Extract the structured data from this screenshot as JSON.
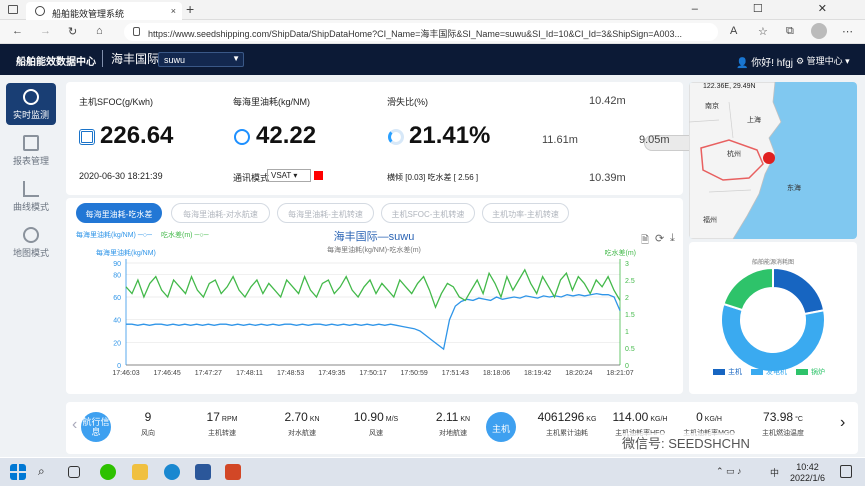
{
  "browser": {
    "tab_title": "船舶能效管理系统",
    "tab_close": "×",
    "new_tab": "+",
    "window_controls": "–  ☐  ✕",
    "url": "https://www.seedshipping.com/ShipData/ShipDataHome?CI_Name=海丰国际&SI_Name=suwu&SI_Id=10&CI_Id=3&ShipSign=A003...",
    "nav": {
      "back": "←",
      "forward": "→",
      "reload": "↻"
    }
  },
  "app": {
    "title": "船舶能效数据中心",
    "company": "海丰国际",
    "ship_select": "suwu",
    "user_greeting": "你好! hfgj",
    "manage_center": "管理中心"
  },
  "sidebar": {
    "items": [
      {
        "label": "实时监测",
        "icon": "gauge-icon",
        "active": true
      },
      {
        "label": "报表管理",
        "icon": "report-icon",
        "active": false
      },
      {
        "label": "曲线模式",
        "icon": "curve-icon",
        "active": false
      },
      {
        "label": "地图模式",
        "icon": "globe-icon",
        "active": false
      }
    ]
  },
  "kpi": {
    "sfoc_label": "主机SFOC(g/Kwh)",
    "sfoc_value": "226.64",
    "timestamp": "2020-06-30 18:21:39",
    "nm_label": "每海里油耗(kg/NM)",
    "nm_value": "42.22",
    "comm_label": "通讯模式",
    "comm_value": "VSAT",
    "slip_label": "滑失比(%)",
    "slip_value": "21.41%",
    "trim_text": "横倾 [0.03] 吃水差 [ 2.56 ]",
    "colors": {
      "sfoc_icon": "#1a73c9",
      "nm_icon": "#1e90ff",
      "slip_icon": "#2aa0ff",
      "status_red": "#ff0000"
    }
  },
  "draft": {
    "fwd": "10.42m",
    "left": "11.61m",
    "right": "9.05m",
    "aft": "10.39m"
  },
  "map": {
    "coords": "122.36E, 29.49N",
    "labels": [
      "南京",
      "上海",
      "杭州",
      "东海",
      "福州"
    ],
    "colors": {
      "sea": "#80c8f0",
      "land": "#f4f4f4",
      "province": "#e86060",
      "ship": "#e02020"
    }
  },
  "chart_tabs": [
    {
      "label": "每海里油耗-吃水差",
      "active": true
    },
    {
      "label": "每海里油耗-对水航速",
      "active": false
    },
    {
      "label": "每海里油耗-主机转速",
      "active": false
    },
    {
      "label": "主机SFOC-主机转速",
      "active": false
    },
    {
      "label": "主机功率-主机转速",
      "active": false
    }
  ],
  "chart_tools": {
    "save": "🗎",
    "refresh": "⟳",
    "download": "⤓"
  },
  "chart_data": {
    "type": "line",
    "title": "海丰国际—suwu",
    "subtitle": "每海里油耗(kg/NM)-吃水差(m)",
    "legend": [
      "每海里油耗(kg/NM)",
      "吃水差(m)"
    ],
    "ylabel_left": "每海里油耗(kg/NM)",
    "ylabel_right": "吃水差(m)",
    "ylim_left": [
      0,
      90
    ],
    "ylim_right": [
      0,
      3
    ],
    "yticks_left": [
      "90",
      "80",
      "60",
      "40",
      "20",
      "0"
    ],
    "yticks_right": [
      "3",
      "2.5",
      "2",
      "1.5",
      "1",
      "0.5",
      "0"
    ],
    "categories": [
      "17:46:03",
      "17:46:45",
      "17:47:27",
      "17:48:11",
      "17:48:53",
      "17:49:35",
      "17:50:17",
      "17:50:59",
      "17:51:43",
      "18:18:06",
      "18:19:42",
      "18:20:24",
      "18:21:07"
    ],
    "series": [
      {
        "name": "每海里油耗(kg/NM)",
        "color": "#2f95e8",
        "values": [
          36,
          36,
          35,
          36,
          35,
          36,
          36,
          35,
          36,
          35,
          36,
          35,
          36,
          35,
          36,
          35,
          36,
          36,
          35,
          36,
          35,
          36,
          35,
          36,
          35,
          36,
          35,
          36,
          36,
          35,
          36,
          35,
          36,
          36,
          35,
          36,
          35,
          36,
          35,
          36,
          35,
          36,
          35,
          36,
          35,
          36,
          35,
          34,
          33,
          32,
          30,
          26,
          22,
          18,
          14,
          40,
          52,
          56,
          58,
          57,
          59,
          58,
          57,
          60,
          58,
          59,
          60,
          59,
          61,
          60,
          59,
          61,
          60,
          61,
          60,
          62,
          61,
          62,
          61,
          62,
          63,
          62,
          62,
          60,
          48
        ]
      },
      {
        "name": "吃水差(m)",
        "color": "#43b94a",
        "values": [
          2.3,
          2.1,
          2.5,
          2.0,
          2.4,
          2.6,
          2.2,
          2.0,
          2.5,
          2.3,
          2.1,
          2.6,
          2.2,
          2.0,
          2.4,
          2.5,
          2.1,
          2.3,
          2.6,
          2.2,
          2.0,
          2.3,
          2.5,
          2.1,
          2.4,
          2.2,
          2.0,
          2.5,
          2.3,
          2.1,
          2.6,
          2.2,
          2.0,
          2.4,
          2.5,
          2.1,
          2.3,
          2.6,
          2.2,
          2.0,
          2.3,
          2.5,
          2.1,
          2.4,
          2.2,
          2.0,
          2.5,
          2.3,
          2.1,
          2.4,
          2.6,
          2.2,
          1.7,
          2.1,
          2.4,
          2.3,
          2.0,
          1.9,
          2.2,
          2.5,
          2.1,
          2.7,
          2.4,
          2.0,
          2.6,
          2.2,
          2.5,
          2.8,
          2.4,
          2.1,
          2.6,
          2.3,
          2.0,
          2.5,
          2.7,
          2.2,
          2.6,
          2.4,
          2.1,
          2.5,
          2.3,
          2.6,
          2.2,
          1.9
        ]
      }
    ]
  },
  "donut": {
    "title": "船舶能源消耗图",
    "slices": [
      {
        "name": "主机",
        "value": 0.22,
        "color": "#1765c1"
      },
      {
        "name": "发电机",
        "value": 0.58,
        "color": "#3aaaf0"
      },
      {
        "name": "锅炉",
        "value": 0.2,
        "color": "#2ec36a"
      }
    ]
  },
  "bottom_bar": {
    "nav_label": "航行信息",
    "engine_label": "主机",
    "stats_left": [
      {
        "value": "9",
        "unit": "",
        "label": "风向"
      },
      {
        "value": "17",
        "unit": "RPM",
        "label": "主机转速"
      },
      {
        "value": "2.70",
        "unit": "KN",
        "label": "对水航速"
      },
      {
        "value": "10.90",
        "unit": "M/S",
        "label": "风速"
      },
      {
        "value": "2.11",
        "unit": "KN",
        "label": "对地航速"
      }
    ],
    "stats_right": [
      {
        "value": "4061296",
        "unit": "KG",
        "label": "主机累计油耗"
      },
      {
        "value": "114.00",
        "unit": "KG/H",
        "label": "主机油耗率HFO"
      },
      {
        "value": "0",
        "unit": "KG/H",
        "label": "主机油耗率MGO"
      },
      {
        "value": "73.98",
        "unit": "°C",
        "label": "主机燃油温度"
      }
    ],
    "watermark": "微信号: SEEDSHCHN"
  },
  "taskbar": {
    "time": "10:42",
    "date": "2022/1/6",
    "ime": "中"
  }
}
